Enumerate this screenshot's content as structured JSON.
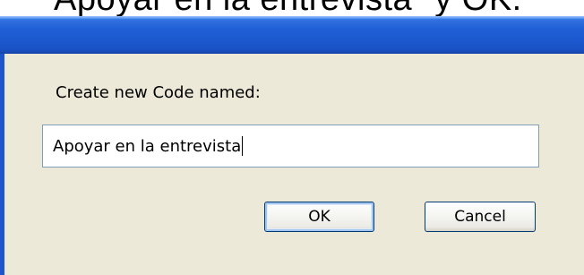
{
  "background": {
    "text": "Apoyar en la entrevista\" y OK."
  },
  "dialog": {
    "prompt_label": "Create new Code named:",
    "input_value": "Apoyar en la entrevista",
    "ok_label": "OK",
    "cancel_label": "Cancel"
  },
  "colors": {
    "titlebar": "#1f5fd6",
    "dialog_body": "#ece9d8",
    "input_border": "#7f9db9",
    "button_border": "#003c74"
  }
}
